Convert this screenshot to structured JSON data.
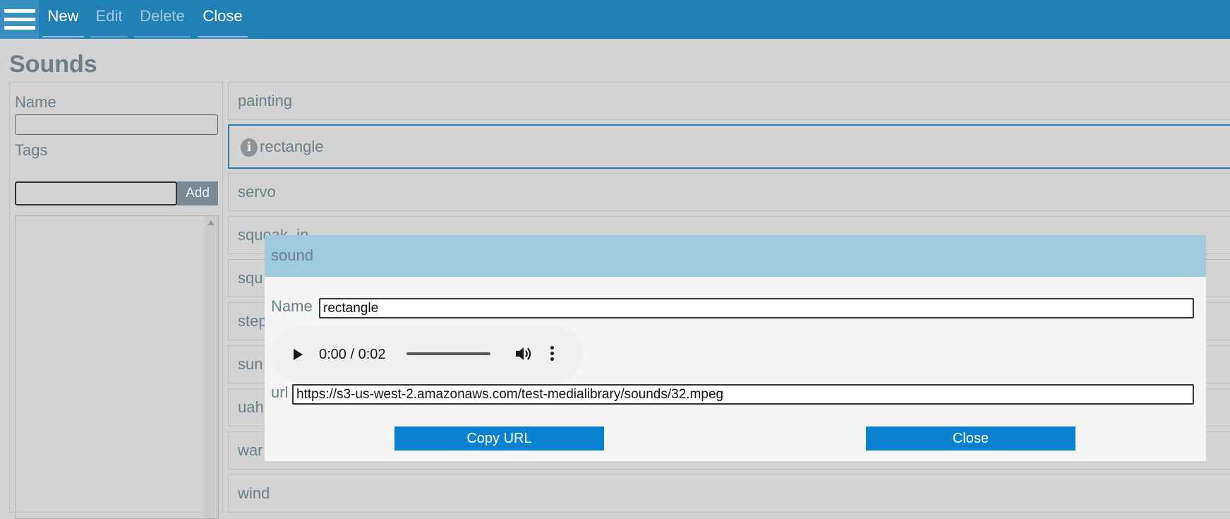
{
  "toolbar": {
    "menu_icon": "hamburger-menu-icon",
    "new_label": "New",
    "edit_label": "Edit",
    "delete_label": "Delete",
    "close_label": "Close"
  },
  "page": {
    "title": "Sounds"
  },
  "filters": {
    "name_label": "Name",
    "name_value": "",
    "tags_label": "Tags",
    "tags_value": "",
    "add_label": "Add"
  },
  "sounds": [
    {
      "name": "painting",
      "selected": false
    },
    {
      "name": "rectangle",
      "selected": true
    },
    {
      "name": "servo",
      "selected": false
    },
    {
      "name": "squeak_in",
      "selected": false
    },
    {
      "name": "squ",
      "selected": false
    },
    {
      "name": "step",
      "selected": false
    },
    {
      "name": "sun",
      "selected": false
    },
    {
      "name": "uah",
      "selected": false
    },
    {
      "name": "war",
      "selected": false
    },
    {
      "name": "wind",
      "selected": false
    }
  ],
  "modal": {
    "title": "sound",
    "name_label": "Name",
    "name_value": "rectangle",
    "audio": {
      "time_display": "0:00 / 0:02",
      "play_icon": "play-icon",
      "volume_icon": "volume-icon",
      "more_icon": "more-options-icon"
    },
    "url_label": "url",
    "url_value": "https://s3-us-west-2.amazonaws.com/test-medialibrary/sounds/32.mpeg",
    "copy_label": "Copy URL",
    "close_label": "Close"
  },
  "colors": {
    "toolbar_bg": "#2180b5",
    "modal_header_bg": "#9fcade",
    "button_bg": "#0a81d1",
    "label_text": "#6c7f88"
  }
}
